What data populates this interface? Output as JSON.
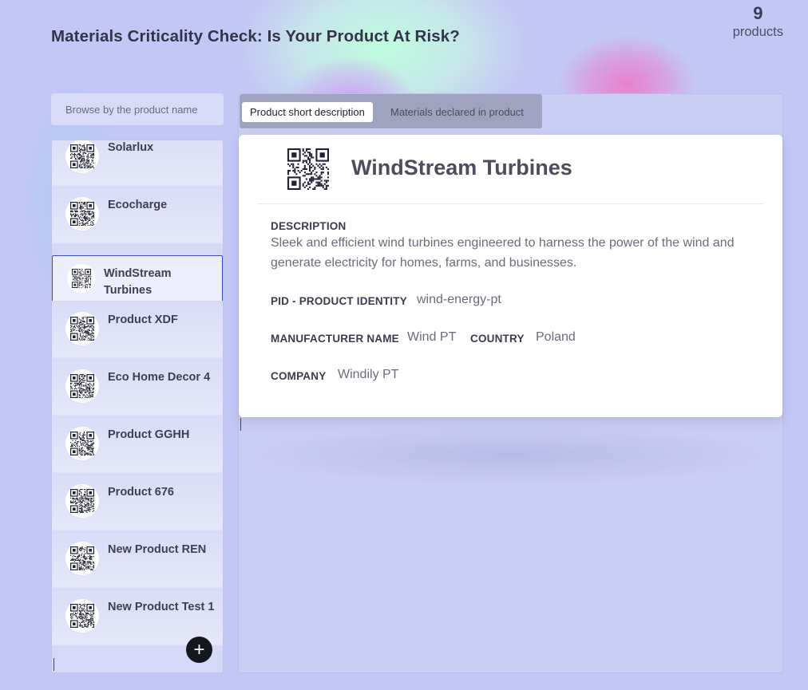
{
  "page": {
    "title": "Materials Criticality Check: Is Your Product At Risk?",
    "count": "9",
    "count_label": "products"
  },
  "search": {
    "placeholder": "Browse by the product name"
  },
  "products": [
    {
      "name": "Solarlux"
    },
    {
      "name": "Ecocharge"
    },
    {
      "name": "WindStream Turbines",
      "selected": true
    },
    {
      "name": "Product XDF"
    },
    {
      "name": "Eco Home Decor 4"
    },
    {
      "name": "Product GGHH"
    },
    {
      "name": "Product 676"
    },
    {
      "name": "New Product REN"
    },
    {
      "name": "New Product Test 1"
    }
  ],
  "add_button": {
    "label": "+"
  },
  "tabs": [
    {
      "label": "Product short description",
      "active": true
    },
    {
      "label": "Materials declared in product",
      "active": false
    }
  ],
  "detail": {
    "title": "WindStream Turbines",
    "description_label": "DESCRIPTION",
    "description": "Sleek and efficient wind turbines engineered to harness the power of the wind and generate electricity for homes, farms, and businesses.",
    "pid_label": "PID - PRODUCT IDENTITY",
    "pid": "wind-energy-pt",
    "manufacturer_label": "MANUFACTURER NAME",
    "manufacturer": "Wind PT",
    "country_label": "COUNTRY",
    "country": "Poland",
    "company_label": "COMPANY",
    "company": "Windily PT"
  },
  "icons": {
    "product_icon": "qr-code-icon",
    "add_icon": "plus-icon"
  },
  "colors": {
    "background": "#c3c7f3",
    "selected_border": "#3a4ec7",
    "add_button": "#15171f",
    "tab_bar": "#a0a3bf"
  }
}
